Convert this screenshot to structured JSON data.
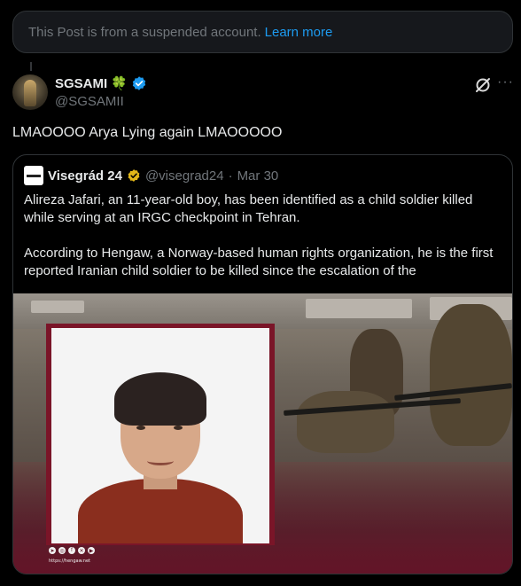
{
  "suspended_notice": {
    "text": "This Post is from a suspended account.",
    "link": "Learn more"
  },
  "author": {
    "name": "SGSAMI",
    "emoji": "🍀",
    "handle": "@SGSAMII"
  },
  "post": {
    "text": "LMAOOOO Arya Lying again LMAOOOOO"
  },
  "quoted": {
    "name": "Visegrád 24",
    "handle": "@visegrad24",
    "separator": "·",
    "date": "Mar 30",
    "paragraph1": "Alireza Jafari, an 11-year-old boy, has been identified as a child soldier killed while serving at an IRGC checkpoint in Tehran.",
    "paragraph2": "According to Hengaw, a Norway-based human rights organization, he is the first reported Iranian child soldier to be killed since the escalation of the",
    "watermark_url": "https://hengaw.net"
  },
  "icons": {
    "verified": "verified-badge-icon",
    "gold": "gold-verified-badge-icon",
    "grok": "grok-icon",
    "more": "more-icon"
  },
  "colors": {
    "background": "#000000",
    "link": "#1d9bf0",
    "verified_blue": "#1d9bf0",
    "verified_gold": "#e2b719",
    "border": "#2f3336",
    "muted": "#71767b",
    "frame": "#7a1528"
  }
}
